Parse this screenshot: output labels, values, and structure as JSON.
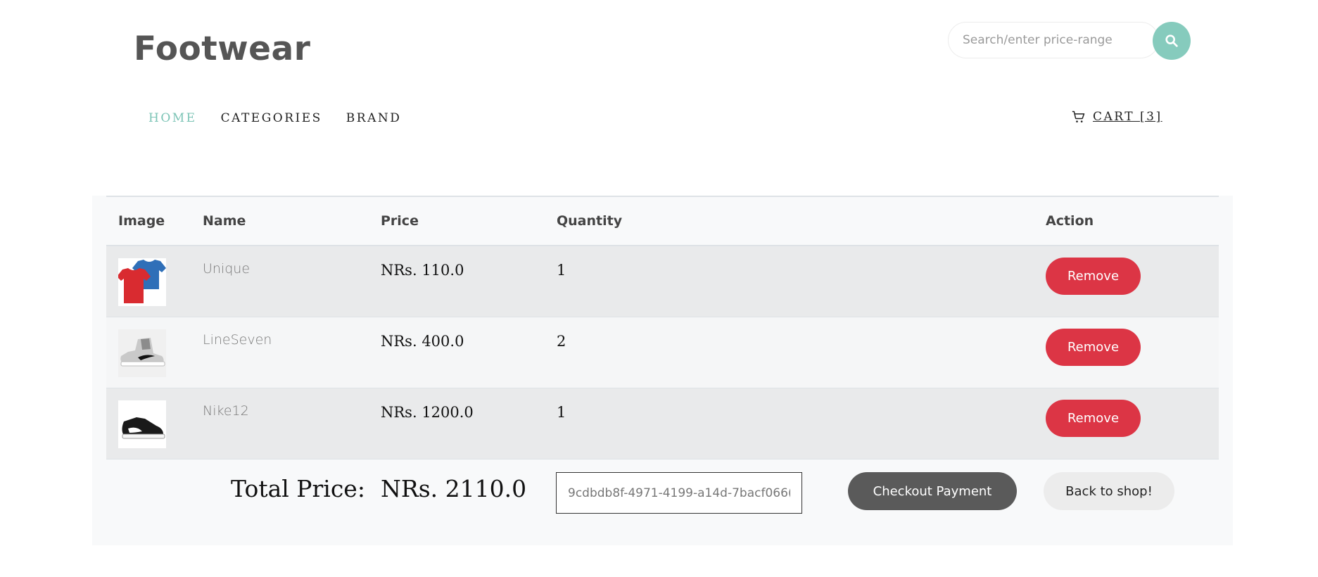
{
  "header": {
    "brand": "Footwear",
    "search": {
      "placeholder": "Search/enter price-range",
      "value": ""
    }
  },
  "nav": {
    "items": [
      {
        "label": "HOME",
        "active": true
      },
      {
        "label": "CATEGORIES",
        "active": false
      },
      {
        "label": "BRAND",
        "active": false
      }
    ],
    "cart_label": "CART [3]"
  },
  "cart_table": {
    "columns": [
      "Image",
      "Name",
      "Price",
      "Quantity",
      "Action"
    ],
    "rows": [
      {
        "image_icon": "tshirts-image",
        "name": "Unique",
        "price": "NRs. 110.0",
        "quantity": "1",
        "action": "Remove"
      },
      {
        "image_icon": "gray-sneaker-image",
        "name": "LineSeven",
        "price": "NRs. 400.0",
        "quantity": "2",
        "action": "Remove"
      },
      {
        "image_icon": "black-sneaker-image",
        "name": "Nike12",
        "price": "NRs. 1200.0",
        "quantity": "1",
        "action": "Remove"
      }
    ]
  },
  "summary": {
    "total_label": "Total Price:",
    "total_value": "NRs. 2110.0",
    "token_value": "9cdbdb8f-4971-4199-a14d-7bacf066(",
    "checkout_label": "Checkout Payment",
    "back_label": "Back to shop!"
  },
  "colors": {
    "accent": "#86cbbd",
    "remove": "#dc3545",
    "checkout": "#5a5a5a"
  }
}
